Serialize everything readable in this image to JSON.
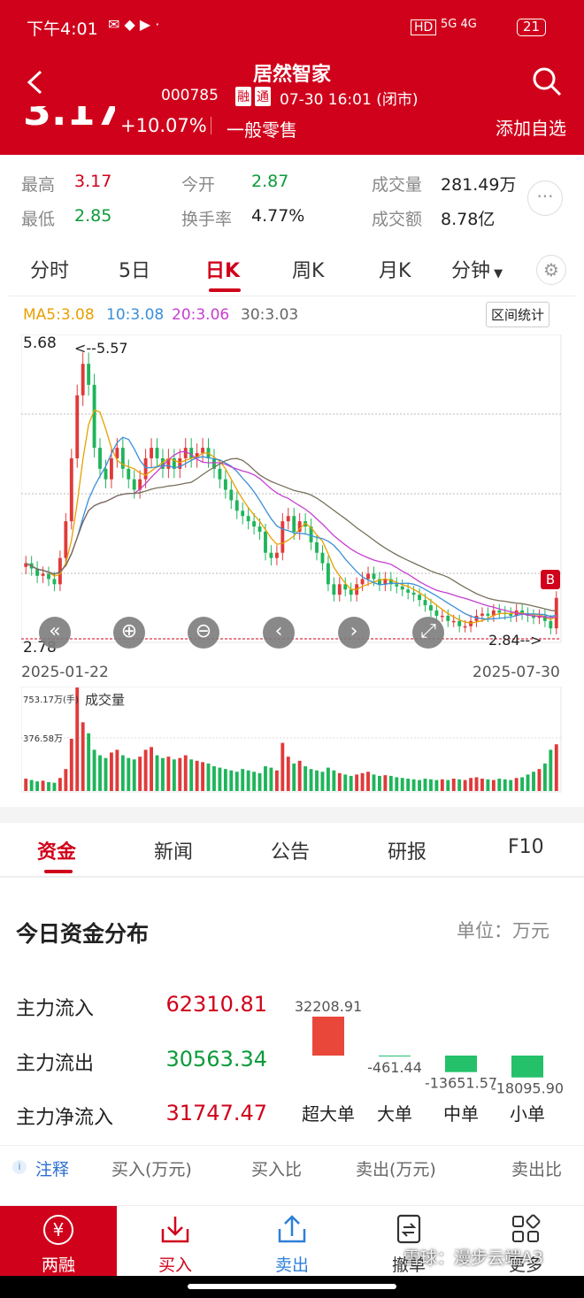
{
  "status_bar": {
    "time": "下午4:01",
    "network": "5G 4G",
    "battery": "21"
  },
  "header": {
    "title": "居然智家",
    "code": "000785",
    "tag_rong": "融",
    "tag_tong": "通",
    "datetime": "07-30 16:01 (闭市)",
    "price": "3.17",
    "change_pct": "+10.07%",
    "industry": "一般零售",
    "add_watch": "添加自选"
  },
  "stats": {
    "high_label": "最高",
    "high": "3.17",
    "open_label": "今开",
    "open": "2.87",
    "volume_label": "成交量",
    "volume": "281.49万",
    "low_label": "最低",
    "low": "2.85",
    "turnover_label": "换手率",
    "turnover": "4.77%",
    "amount_label": "成交额",
    "amount": "8.78亿"
  },
  "chart_tabs": [
    "分时",
    "5日",
    "日K",
    "周K",
    "月K",
    "分钟"
  ],
  "ma": {
    "ma5": "MA5:3.08",
    "ma10": "10:3.08",
    "ma20": "20:3.06",
    "ma30": "30:3.03",
    "interval_btn": "区间统计"
  },
  "chart_data": {
    "type": "candlestick",
    "ylim": [
      2.78,
      5.68
    ],
    "max_label": "<--5.57",
    "min_label": "2.84-->",
    "date_start": "2025-01-22",
    "date_end": "2025-07-30",
    "buy_marker": "B",
    "close": [
      3.5,
      3.45,
      3.38,
      3.4,
      3.35,
      3.3,
      3.55,
      3.9,
      4.5,
      5.1,
      5.4,
      5.2,
      4.6,
      4.4,
      4.3,
      4.5,
      4.6,
      4.4,
      4.3,
      4.2,
      4.3,
      4.5,
      4.6,
      4.5,
      4.4,
      4.5,
      4.4,
      4.5,
      4.6,
      4.5,
      4.55,
      4.6,
      4.5,
      4.4,
      4.3,
      4.2,
      4.1,
      4.0,
      3.95,
      3.9,
      3.85,
      3.8,
      3.6,
      3.55,
      3.6,
      3.9,
      3.95,
      3.8,
      3.9,
      3.85,
      3.7,
      3.6,
      3.5,
      3.3,
      3.2,
      3.3,
      3.25,
      3.2,
      3.3,
      3.35,
      3.4,
      3.35,
      3.3,
      3.35,
      3.3,
      3.28,
      3.25,
      3.22,
      3.2,
      3.15,
      3.1,
      3.05,
      3.0,
      3.0,
      2.95,
      2.95,
      2.9,
      2.9,
      2.95,
      3.0,
      3.02,
      3.0,
      3.05,
      3.03,
      3.02,
      3.0,
      3.05,
      3.02,
      3.0,
      2.98,
      3.0,
      2.95,
      2.88,
      3.17
    ],
    "volume_max_label": "753.17万(手)",
    "volume_mid_label": "376.58万",
    "volume_title": "成交量",
    "volume": [
      90,
      80,
      70,
      75,
      65,
      60,
      95,
      160,
      380,
      753,
      500,
      420,
      300,
      260,
      240,
      280,
      300,
      260,
      240,
      230,
      250,
      300,
      320,
      260,
      240,
      250,
      230,
      240,
      260,
      230,
      220,
      210,
      200,
      180,
      170,
      160,
      150,
      140,
      160,
      150,
      140,
      130,
      180,
      170,
      150,
      350,
      250,
      200,
      220,
      180,
      160,
      150,
      140,
      170,
      150,
      130,
      120,
      110,
      120,
      130,
      140,
      120,
      110,
      115,
      110,
      100,
      95,
      90,
      85,
      80,
      90,
      85,
      80,
      85,
      80,
      90,
      85,
      80,
      95,
      100,
      90,
      85,
      80,
      90,
      85,
      80,
      95,
      100,
      120,
      140,
      160,
      200,
      300,
      340
    ]
  },
  "bottom_tabs": [
    "资金",
    "新闻",
    "公告",
    "研报",
    "F10"
  ],
  "fund": {
    "title": "今日资金分布",
    "unit": "单位：万元",
    "inflow_label": "主力流入",
    "inflow": "62310.81",
    "outflow_label": "主力流出",
    "outflow": "30563.34",
    "net_label": "主力净流入",
    "net": "31747.47",
    "bars": [
      {
        "label": "超大单",
        "value": 32208.91,
        "text": "32208.91"
      },
      {
        "label": "大单",
        "value": -461.44,
        "text": "-461.44"
      },
      {
        "label": "中单",
        "value": -13651.57,
        "text": "-13651.57"
      },
      {
        "label": "小单",
        "value": -18095.9,
        "text": "-18095.90"
      }
    ]
  },
  "table_header": {
    "note": "注释",
    "buy": "买入(万元)",
    "buy_ratio": "买入比",
    "sell": "卖出(万元)",
    "sell_ratio": "卖出比"
  },
  "bottom_bar": [
    {
      "label": "两融",
      "icon": "yen-icon"
    },
    {
      "label": "买入",
      "icon": "buy-icon"
    },
    {
      "label": "卖出",
      "icon": "sell-icon"
    },
    {
      "label": "撤单",
      "icon": "cancel-order-icon"
    },
    {
      "label": "更多",
      "icon": "more-grid-icon"
    }
  ],
  "watermark": "雪球：漫步云端A3",
  "colors": {
    "up": "#e03a3a",
    "down": "#1fb55b",
    "brand": "#d0021b"
  }
}
